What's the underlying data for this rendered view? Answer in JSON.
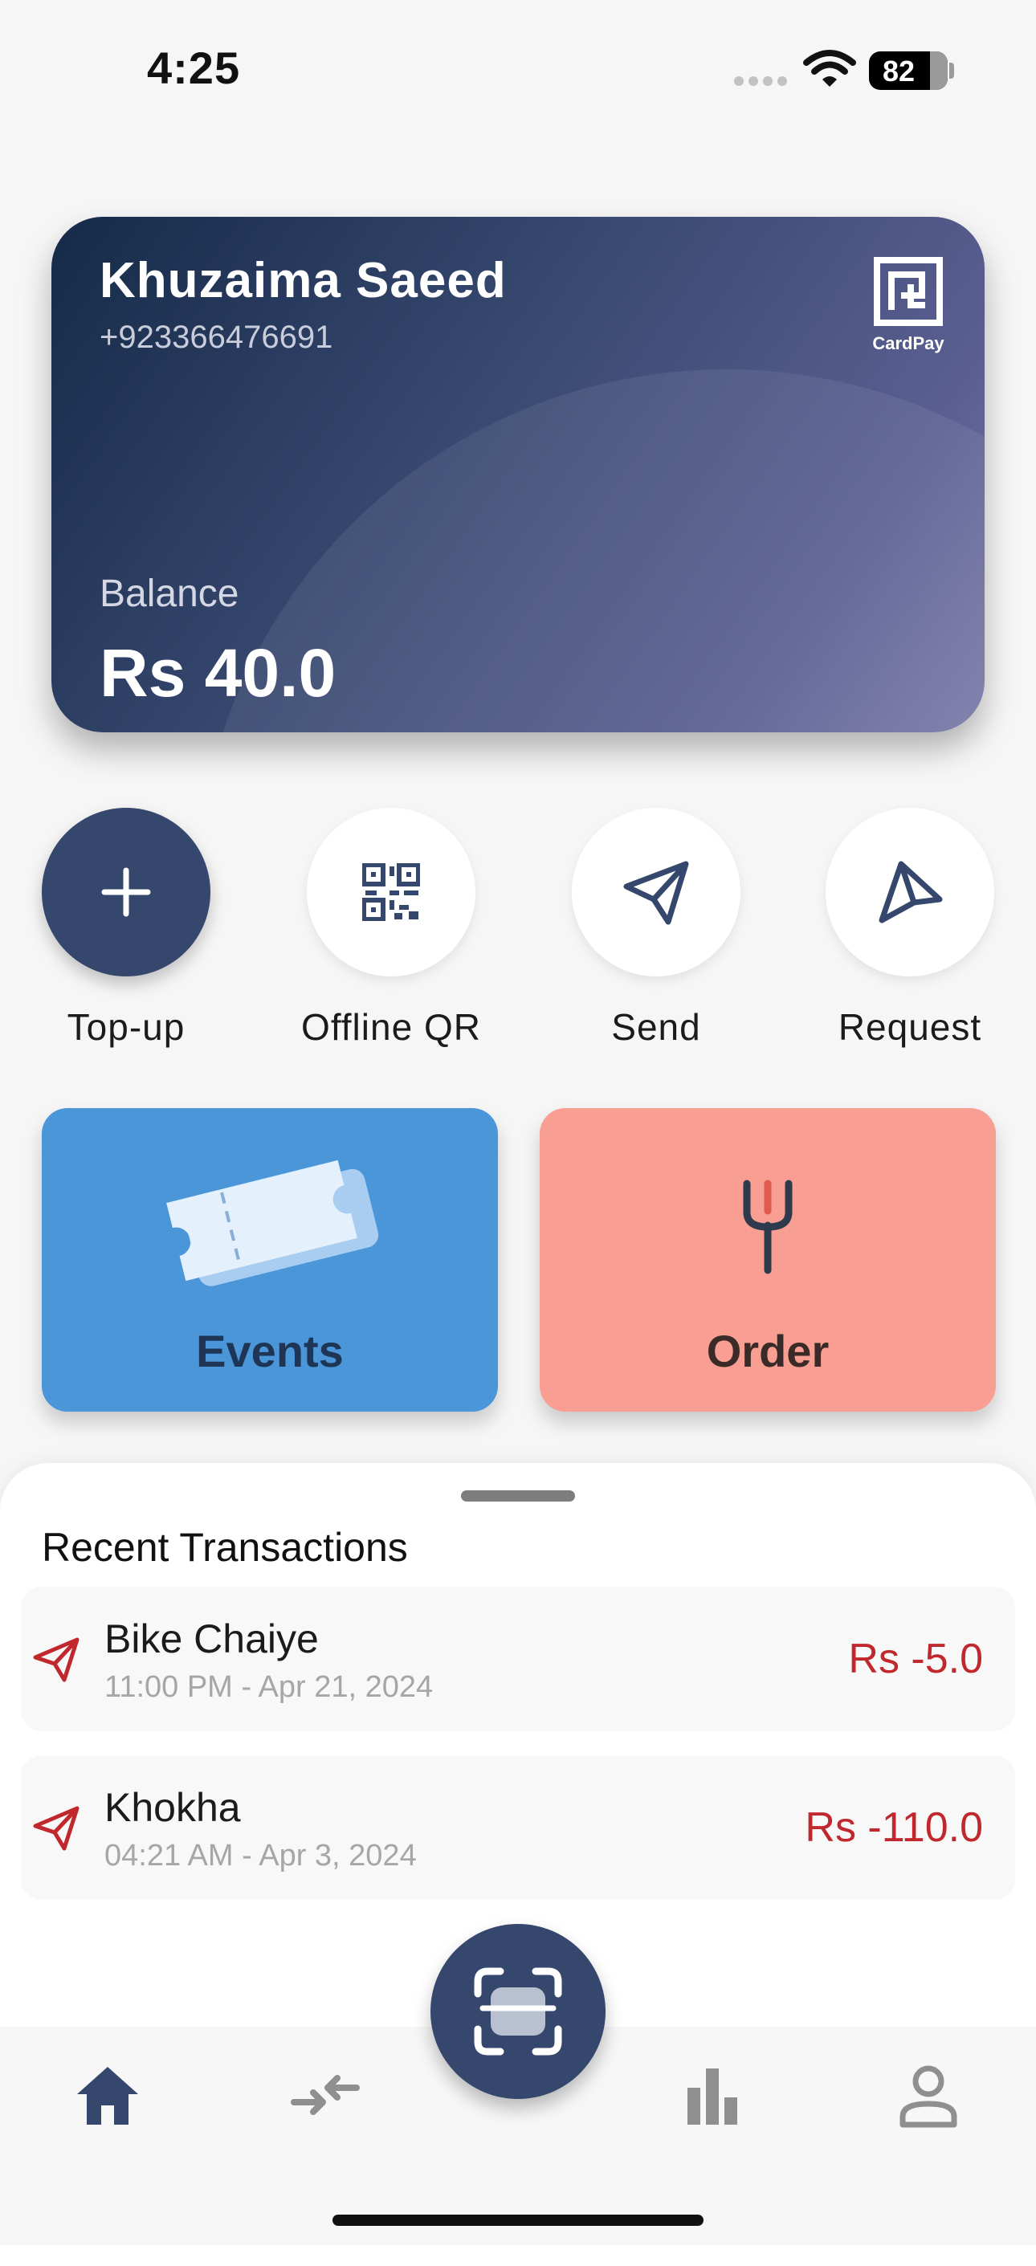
{
  "status_bar": {
    "time": "4:25",
    "battery": "82"
  },
  "card": {
    "name": "Khuzaima Saeed",
    "phone": "+923366476691",
    "logo_text": "CardPay",
    "balance_label": "Balance",
    "balance": "Rs 40.0"
  },
  "actions": [
    {
      "label": "Top-up",
      "icon": "plus-icon"
    },
    {
      "label": "Offline QR",
      "icon": "qr-code-icon"
    },
    {
      "label": "Send",
      "icon": "send-icon"
    },
    {
      "label": "Request",
      "icon": "request-icon"
    }
  ],
  "tiles": [
    {
      "label": "Events",
      "icon": "ticket-icon",
      "color": "#4a96d9"
    },
    {
      "label": "Order",
      "icon": "fork-icon",
      "color": "#f99e92"
    }
  ],
  "transactions": {
    "title": "Recent Transactions",
    "items": [
      {
        "name": "Bike Chaiye",
        "time": "11:00 PM - Apr 21, 2024",
        "amount": "Rs -5.0"
      },
      {
        "name": "Khokha",
        "time": "04:21 AM - Apr 3, 2024",
        "amount": "Rs -110.0"
      }
    ]
  },
  "nav": {
    "items": [
      "home-icon",
      "transfer-icon",
      "scan-icon",
      "stats-icon",
      "profile-icon"
    ],
    "active": "home-icon",
    "active_color": "#35476c",
    "inactive_color": "#8f8f8f"
  }
}
